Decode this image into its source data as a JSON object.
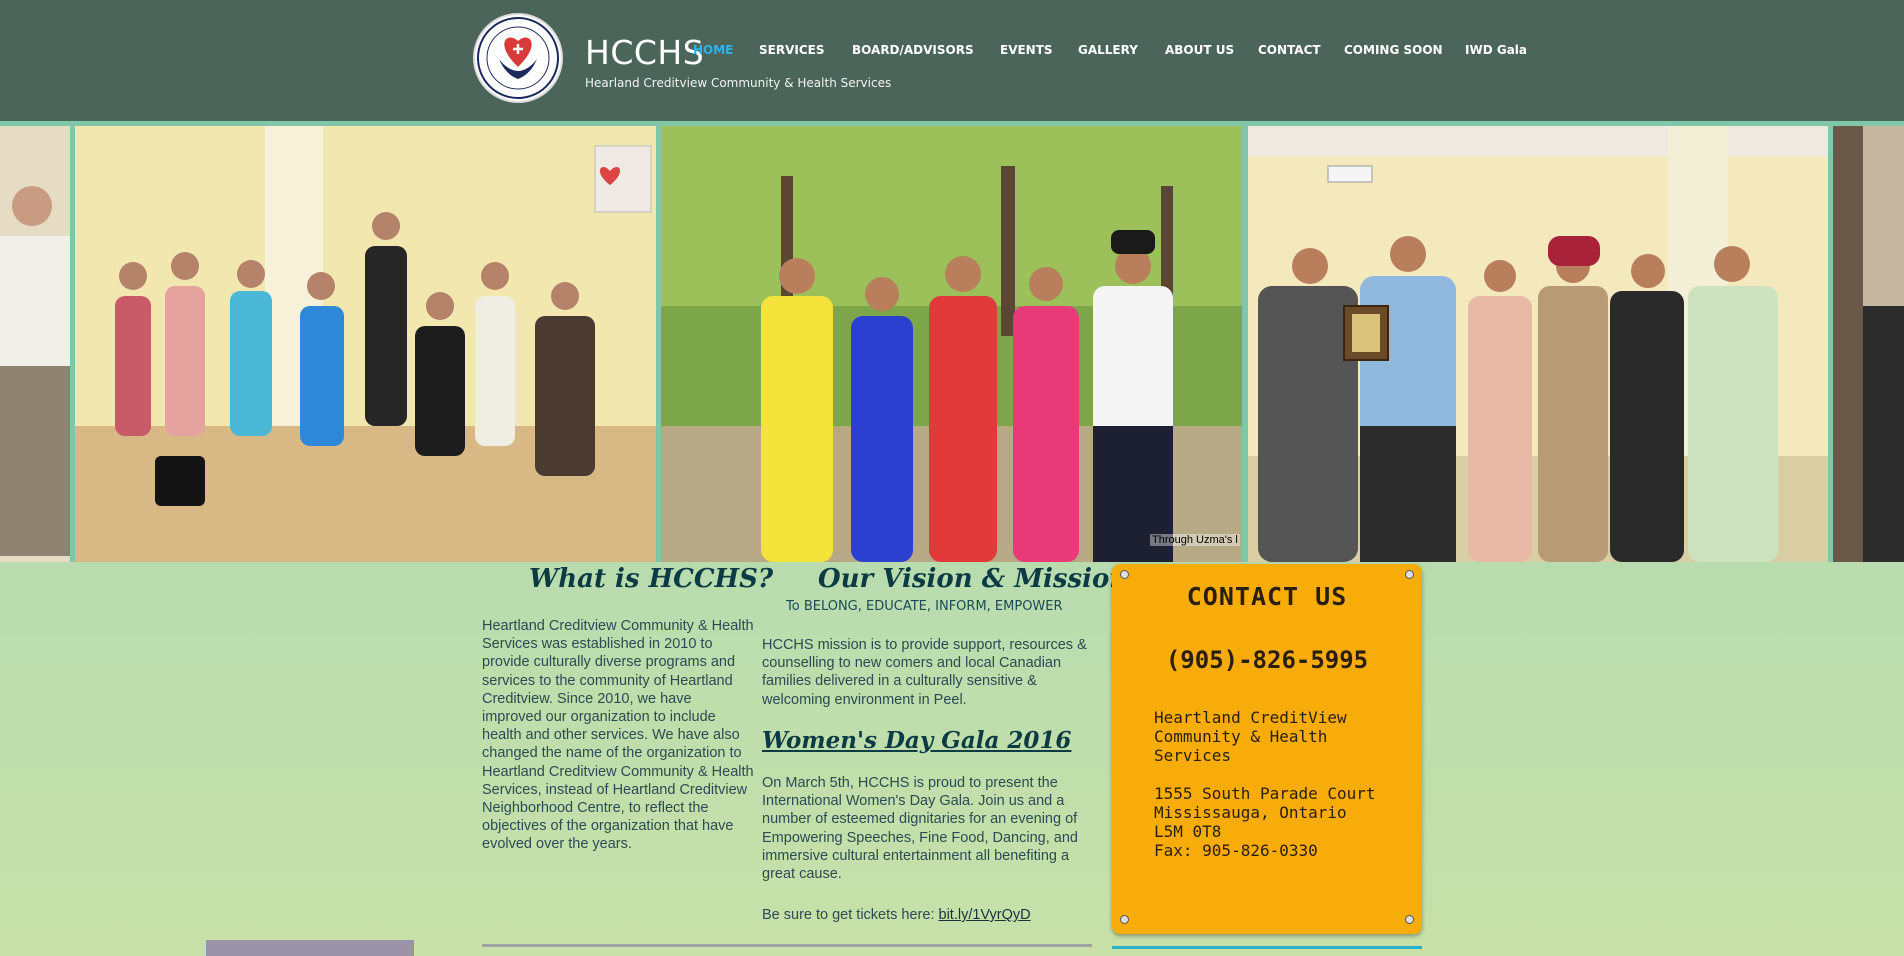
{
  "header": {
    "brand": "HCCHS",
    "tagline": "Hearland Creditview Community & Health Services",
    "logo_text_top": "Heartland Creditview",
    "logo_text_bottom": "Community & Health Services"
  },
  "nav": {
    "items": [
      {
        "label": "HOME",
        "active": true
      },
      {
        "label": "SERVICES"
      },
      {
        "label": "BOARD/ADVISORS"
      },
      {
        "label": "EVENTS"
      },
      {
        "label": "GALLERY"
      },
      {
        "label": "ABOUT US"
      },
      {
        "label": "CONTACT"
      },
      {
        "label": "COMING SOON"
      },
      {
        "label": "IWD Gala"
      }
    ]
  },
  "slideshow": {
    "watermark": "Through Uzma's l"
  },
  "about": {
    "heading": "What is HCCHS?",
    "body": "Heartland Creditview Community & Health Services was established in 2010 to provide culturally diverse programs and services to the community of Heartland Creditview. Since 2010, we have improved our organization to include health and other services. We have also changed the name of the organization to Heartland Creditview Community & Health Services, instead of Heartland Creditview Neighborhood Centre, to reflect the objectives of the organization that have evolved over the years."
  },
  "vision": {
    "heading": "Our Vision & Mission",
    "subheading": "To BELONG, EDUCATE, INFORM, EMPOWER",
    "body": "HCCHS mission is to provide support, resources & counselling to new comers and local Canadian families delivered in a culturally sensitive & welcoming environment in Peel."
  },
  "gala": {
    "heading": "Women's Day Gala 2016",
    "body": "On March 5th, HCCHS is proud to present the International Women's Day Gala. Join us and a number of esteemed dignitaries for an evening of Empowering Speeches, Fine Food, Dancing, and immersive cultural entertainment all benefiting a great cause.",
    "tickets_prefix": "Be sure to get tickets here: ",
    "tickets_link": "bit.ly/1VyrQyD"
  },
  "contact": {
    "title": "CONTACT US",
    "phone": "(905)-826-5995",
    "org_lines": [
      "Heartland CreditView",
      "Community & Health",
      "Services"
    ],
    "address_lines": [
      "1555 South Parade Court",
      "Mississauga, Ontario",
      "L5M 0T8",
      "Fax: 905-826-0330"
    ]
  },
  "colors": {
    "header_bg": "#4b655b",
    "accent_active": "#2cb3f0",
    "page_bg_top": "#a7d5b4",
    "contact_bg": "#f7ac0a",
    "heading_color": "#0c3b45"
  }
}
